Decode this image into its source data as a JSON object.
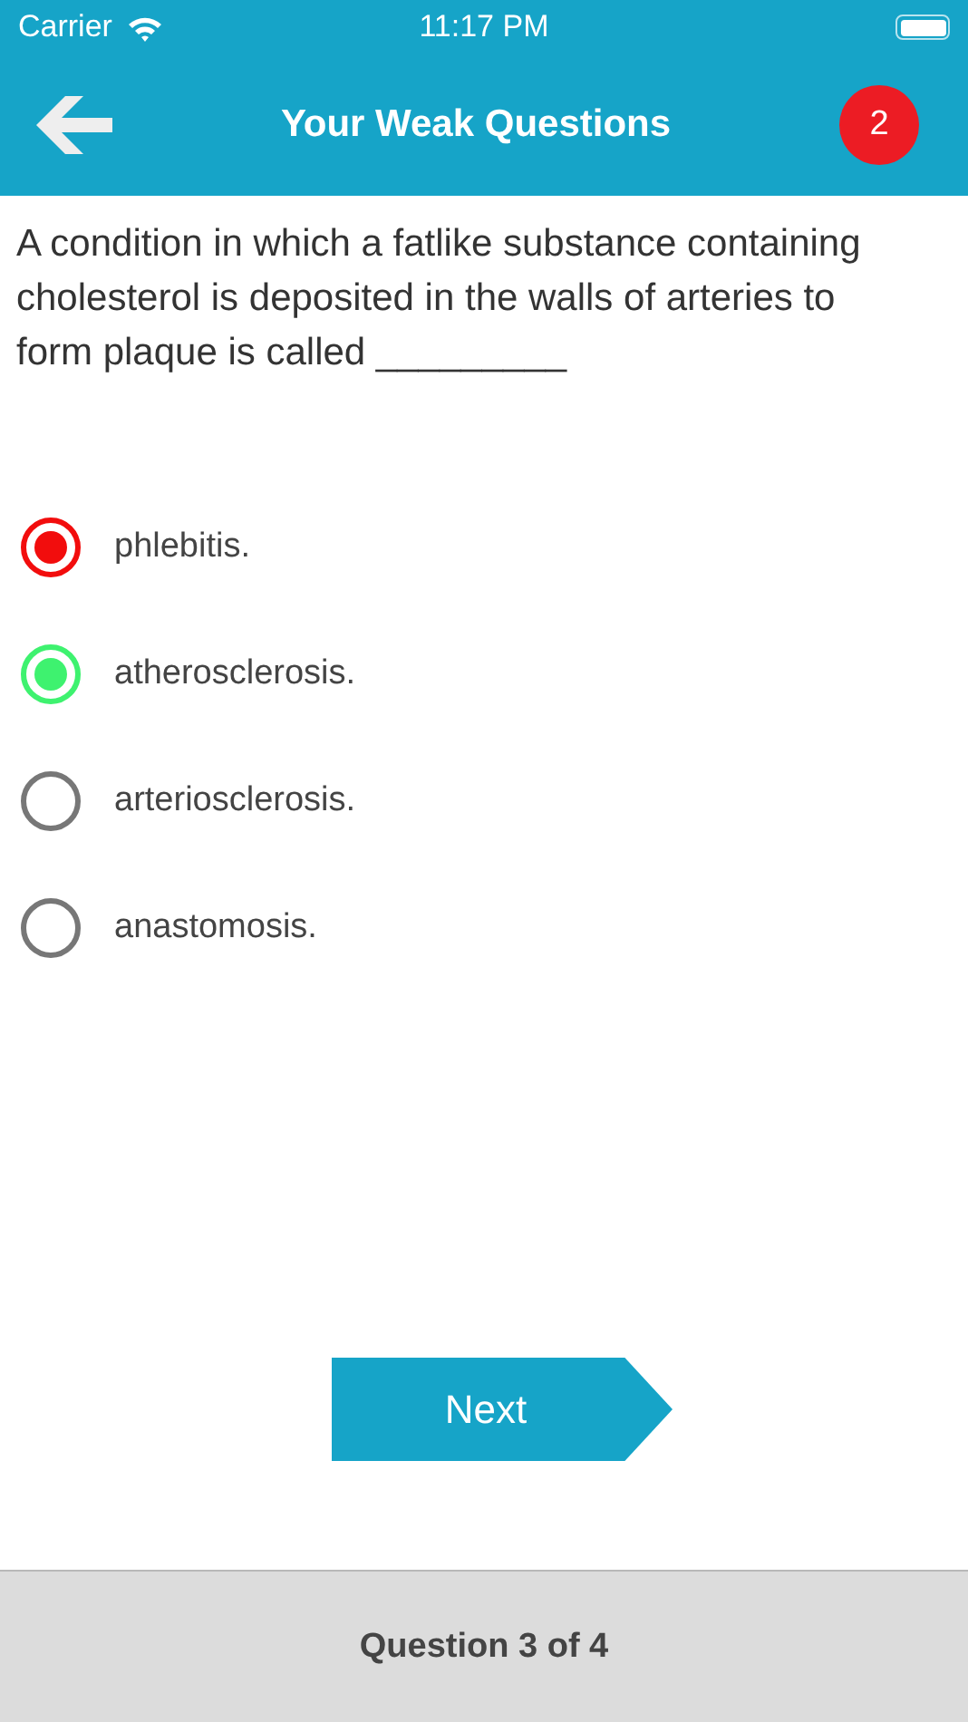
{
  "status_bar": {
    "carrier": "Carrier",
    "time": "11:17 PM"
  },
  "header": {
    "title": "Your Weak Questions",
    "badge": "2"
  },
  "question": "A condition in which a fatlike substance containing cholesterol is deposited in the walls of arteries to form plaque is called _________",
  "options": [
    {
      "label": "phlebitis.",
      "selected": true,
      "correct": false
    },
    {
      "label": "atherosclerosis.",
      "selected": false,
      "correct": true
    },
    {
      "label": "arteriosclerosis.",
      "selected": false,
      "correct": false
    },
    {
      "label": "anastomosis.",
      "selected": false,
      "correct": false
    }
  ],
  "next_button": "Next",
  "footer": "Question 3 of 4"
}
